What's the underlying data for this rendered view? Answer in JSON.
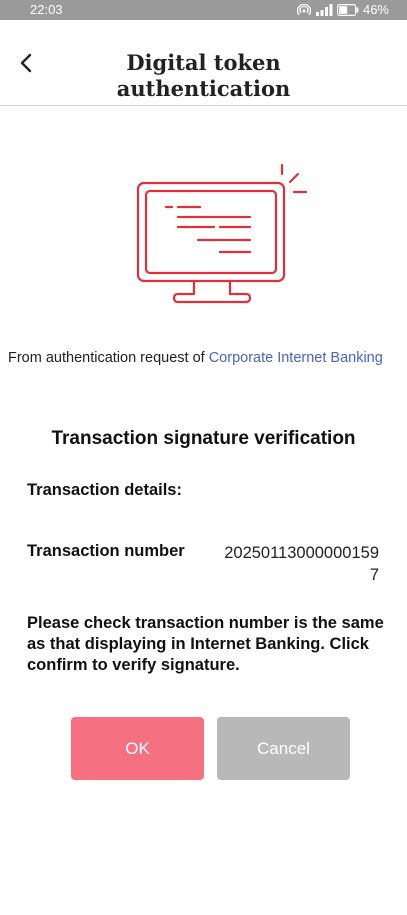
{
  "status_bar": {
    "time": "22:03",
    "battery_percent": "46%",
    "icons": [
      "hotspot-icon",
      "signal-icon",
      "battery-icon"
    ]
  },
  "header": {
    "back_icon": "chevron-left-icon",
    "title": "Digital token authentication"
  },
  "illustration": {
    "icon": "monitor-document-icon",
    "accent_color": "#e0303c"
  },
  "request": {
    "prefix": "From authentication request of ",
    "source_link": "Corporate Internet Banking",
    "link_color": "#4a63c9"
  },
  "verification": {
    "heading": "Transaction signature verification",
    "details_label": "Transaction details:",
    "transaction_number_label": "Transaction number",
    "transaction_number_value": "202501130000001597",
    "notice": "Please check transaction number is the same as that displaying in Internet Banking. Click confirm to verify signature."
  },
  "actions": {
    "ok_label": "OK",
    "cancel_label": "Cancel",
    "ok_color": "#f57182",
    "cancel_color": "#b8b8b8"
  }
}
